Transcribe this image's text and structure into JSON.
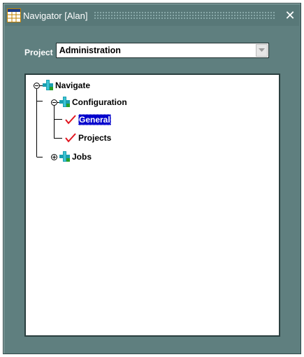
{
  "window": {
    "title": "Navigator [Alan]",
    "close_symbol": "✕",
    "app_icon": "grid-icon"
  },
  "project": {
    "label": "Project",
    "selected": "Administration",
    "dropdown_icon": "chevron-down-icon"
  },
  "tree": {
    "nodes": [
      {
        "label": "Navigate",
        "icon": "plus-cross-icon",
        "state": "expanded"
      },
      {
        "label": "Configuration",
        "icon": "plus-cross-icon",
        "state": "expanded"
      },
      {
        "label": "General",
        "icon": "red-check-icon",
        "state": "leaf",
        "selected": true
      },
      {
        "label": "Projects",
        "icon": "red-check-icon",
        "state": "leaf"
      },
      {
        "label": "Jobs",
        "icon": "plus-cross-icon",
        "state": "collapsed"
      }
    ]
  },
  "colors": {
    "window_bg": "#5f7f7f",
    "selection_bg": "#0000cc",
    "check_red": "#e0141e",
    "icon_teal": "#1a9fb0",
    "icon_green": "#28a028"
  }
}
